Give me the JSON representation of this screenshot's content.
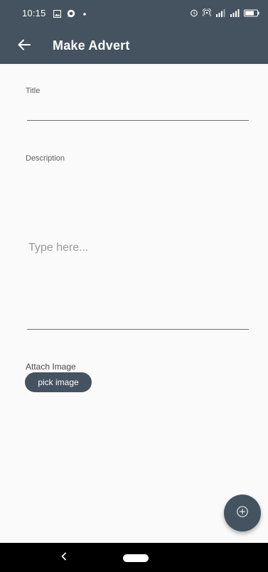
{
  "status_bar": {
    "time": "10:15",
    "left_icons": [
      "image-icon",
      "whatsapp-icon",
      "dot-icon"
    ],
    "right_icons": [
      "alarm-icon",
      "hotspot-icon",
      "signal-icon",
      "signal-icon",
      "battery-icon"
    ]
  },
  "app_bar": {
    "back_icon": "arrow-left-icon",
    "title": "Make Advert"
  },
  "form": {
    "title_label": "Title",
    "title_value": "",
    "description_label": "Description",
    "description_placeholder": "Type here...",
    "attach_label": "Attach Image",
    "pick_image_label": "pick image"
  },
  "fab": {
    "icon": "add-circle-icon"
  },
  "nav_bar": {
    "back_icon": "chevron-left-icon",
    "home_icon": "home-pill-icon"
  },
  "colors": {
    "primary": "#44535f",
    "background": "#fafafa",
    "nav": "#000000"
  }
}
